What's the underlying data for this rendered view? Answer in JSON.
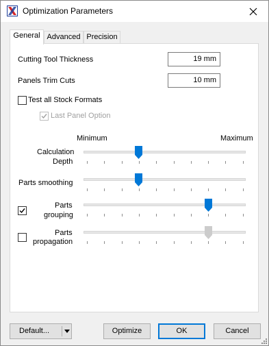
{
  "window": {
    "title": "Optimization Parameters"
  },
  "icons": {
    "app": "app-logo-icon",
    "close": "close-icon",
    "dropdown": "chevron-down-icon",
    "check": "checkmark-icon",
    "grip": "resize-grip-icon"
  },
  "tabs": [
    {
      "label": "General",
      "active": true
    },
    {
      "label": "Advanced",
      "active": false
    },
    {
      "label": "Precision",
      "active": false
    }
  ],
  "fields": {
    "cutting_tool_thickness": {
      "label": "Cutting Tool Thickness",
      "value": "19 mm"
    },
    "panels_trim_cuts": {
      "label": "Panels Trim Cuts",
      "value": "10 mm"
    }
  },
  "checkboxes": {
    "test_all_stock_formats": {
      "label": "Test all Stock Formats",
      "checked": false,
      "enabled": true
    },
    "last_panel_option": {
      "label": "Last Panel Option",
      "checked": true,
      "enabled": false
    }
  },
  "slider_scale": {
    "min_label": "Minimum",
    "max_label": "Maximum",
    "tick_count": 10
  },
  "sliders": [
    {
      "label_line1": "Calculation",
      "label_line2": "Depth",
      "value_fraction": 0.34,
      "enabled": true,
      "has_checkbox": false
    },
    {
      "label_line1": "Parts smoothing",
      "label_line2": "",
      "value_fraction": 0.34,
      "enabled": true,
      "has_checkbox": false
    },
    {
      "label_line1": "Parts",
      "label_line2": "grouping",
      "value_fraction": 0.77,
      "enabled": true,
      "has_checkbox": true,
      "checked": true
    },
    {
      "label_line1": "Parts",
      "label_line2": "propagation",
      "value_fraction": 0.77,
      "enabled": false,
      "has_checkbox": true,
      "checked": false
    }
  ],
  "buttons": {
    "default": "Default...",
    "optimize": "Optimize",
    "ok": "OK",
    "cancel": "Cancel"
  },
  "colors": {
    "accent": "#0078d7",
    "thumb_active": "#0078d7",
    "thumb_disabled": "#cccccc",
    "disabled_text": "#a0a0a0"
  }
}
